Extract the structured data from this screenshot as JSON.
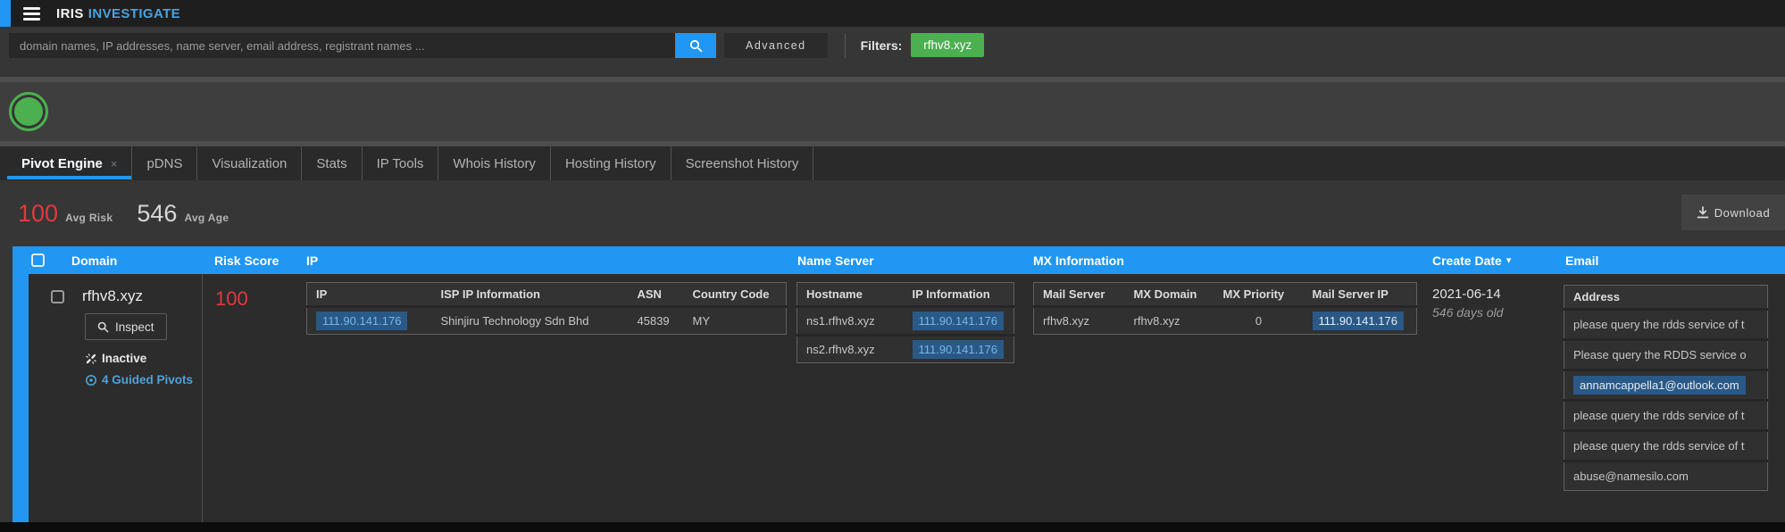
{
  "colors": {
    "accent_blue": "#2196f3",
    "brand_blue": "#4aa3dc",
    "filter_green": "#4caf50",
    "status_green": "#4caf50",
    "risk_red": "#e0393e",
    "highlight_bg": "#2b5986",
    "highlight_text": "#74b6ec"
  },
  "topbar": {
    "brand_iris": "IRIS",
    "brand_investigate": "INVESTIGATE"
  },
  "search": {
    "placeholder": "domain names, IP addresses, name server, email address, registrant names ...",
    "advanced_label": "Advanced",
    "filters_label": "Filters:",
    "filter_chip": "rfhv8.xyz"
  },
  "tabs": [
    {
      "label": "Pivot Engine",
      "active": true
    },
    {
      "label": "pDNS"
    },
    {
      "label": "Visualization"
    },
    {
      "label": "Stats"
    },
    {
      "label": "IP Tools"
    },
    {
      "label": "Whois History"
    },
    {
      "label": "Hosting History"
    },
    {
      "label": "Screenshot History"
    }
  ],
  "icons": {
    "close_tab": "×",
    "sort_desc": "▾"
  },
  "stats": {
    "avg_risk_value": "100",
    "avg_risk_label": "Avg Risk",
    "avg_age_value": "546",
    "avg_age_label": "Avg Age",
    "download_label": "Download"
  },
  "table": {
    "columns": {
      "domain": "Domain",
      "risk_score": "Risk Score",
      "ip": "IP",
      "name_server": "Name Server",
      "mx_information": "MX Information",
      "create_date": "Create Date",
      "email": "Email"
    },
    "row": {
      "domain": "rfhv8.xyz",
      "inspect_label": "Inspect",
      "status_label": "Inactive",
      "guided_pivots_label": "4 Guided Pivots",
      "risk_score": "100",
      "ip_table": {
        "headers": {
          "ip": "IP",
          "isp": "ISP IP Information",
          "asn": "ASN",
          "country_code": "Country Code"
        },
        "row": {
          "ip": "111.90.141.176",
          "isp": "Shinjiru Technology Sdn Bhd",
          "asn": "45839",
          "country_code": "MY"
        }
      },
      "ns_table": {
        "headers": {
          "hostname": "Hostname",
          "ip_information": "IP Information"
        },
        "rows": [
          {
            "hostname": "ns1.rfhv8.xyz",
            "ip": "111.90.141.176"
          },
          {
            "hostname": "ns2.rfhv8.xyz",
            "ip": "111.90.141.176"
          }
        ]
      },
      "mx_table": {
        "headers": {
          "mail_server": "Mail Server",
          "mx_domain": "MX Domain",
          "mx_priority": "MX Priority",
          "mail_server_ip": "Mail Server IP"
        },
        "row": {
          "mail_server": "rfhv8.xyz",
          "mx_domain": "rfhv8.xyz",
          "mx_priority": "0",
          "mail_server_ip": "111.90.141.176"
        }
      },
      "create_date": "2021-06-14",
      "age": "546 days old",
      "email_table": {
        "header": "Address",
        "rows": [
          {
            "text": "please query the rdds service of t"
          },
          {
            "text": "Please query the RDDS service o"
          },
          {
            "text": "annamcappella1@outlook.com",
            "highlighted": true
          },
          {
            "text": "please query the rdds service of t"
          },
          {
            "text": "please query the rdds service of t"
          },
          {
            "text": "abuse@namesilo.com"
          }
        ]
      }
    }
  }
}
